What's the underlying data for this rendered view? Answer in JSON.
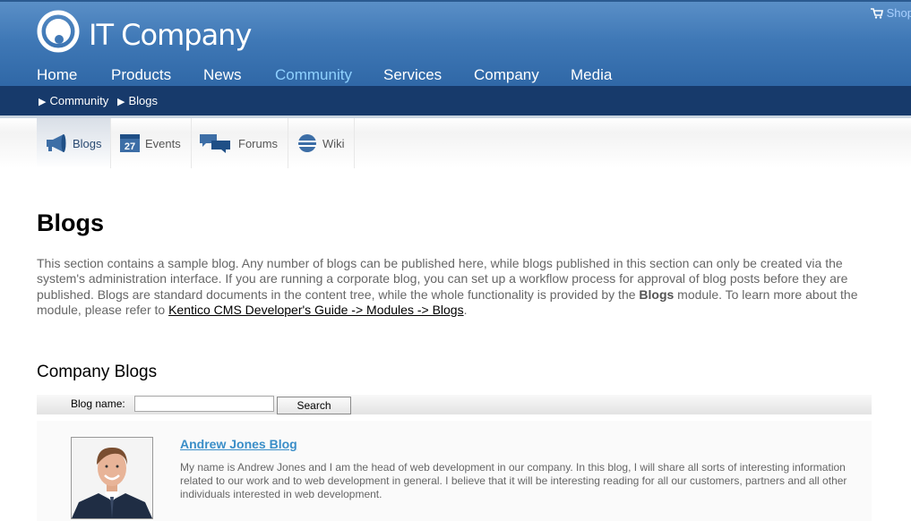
{
  "header": {
    "logo_text": "IT Company",
    "cart_label": "Shop",
    "nav": [
      {
        "label": "Home"
      },
      {
        "label": "Products"
      },
      {
        "label": "News"
      },
      {
        "label": "Community",
        "active": true
      },
      {
        "label": "Services"
      },
      {
        "label": "Company"
      },
      {
        "label": "Media"
      }
    ]
  },
  "breadcrumb": [
    "Community",
    "Blogs"
  ],
  "subnav": [
    {
      "label": "Blogs",
      "icon": "megaphone-icon",
      "active": true
    },
    {
      "label": "Events",
      "icon": "calendar-icon",
      "icon_text": "27"
    },
    {
      "label": "Forums",
      "icon": "speech-bubbles-icon"
    },
    {
      "label": "Wiki",
      "icon": "globe-icon"
    }
  ],
  "main": {
    "title": "Blogs",
    "intro": {
      "part1": "This section contains a sample blog. Any number of blogs can be published here, while blogs published in this section can only be created via the system's administration interface. If you are running a corporate blog, you can set up a workflow process for approval of blog posts before they are published. Blogs are standard documents in the content tree, while the whole functionality is provided by the ",
      "bold": "Blogs",
      "part2": " module. To learn more about the module, please refer to ",
      "link": "Kentico CMS Developer's Guide -> Modules -> Blogs",
      "end": "."
    },
    "section_title": "Company Blogs",
    "filter": {
      "label": "Blog name:",
      "value": "",
      "button": "Search"
    },
    "blogs": [
      {
        "name": "Andrew Jones Blog",
        "description": "My name is Andrew Jones and I am the head of web development in our company. In this blog, I will share all sorts of interesting information related to our work and to web development in general. I believe that it will be interesting reading for all our customers, partners and all other individuals interested in web development."
      }
    ]
  },
  "colors": {
    "header_top": "#5a8fc7",
    "header_bottom": "#2f67a6",
    "breadcrumb_bar": "#173a6b",
    "nav_active": "#8fd1ff",
    "link": "#3a8ec8"
  }
}
